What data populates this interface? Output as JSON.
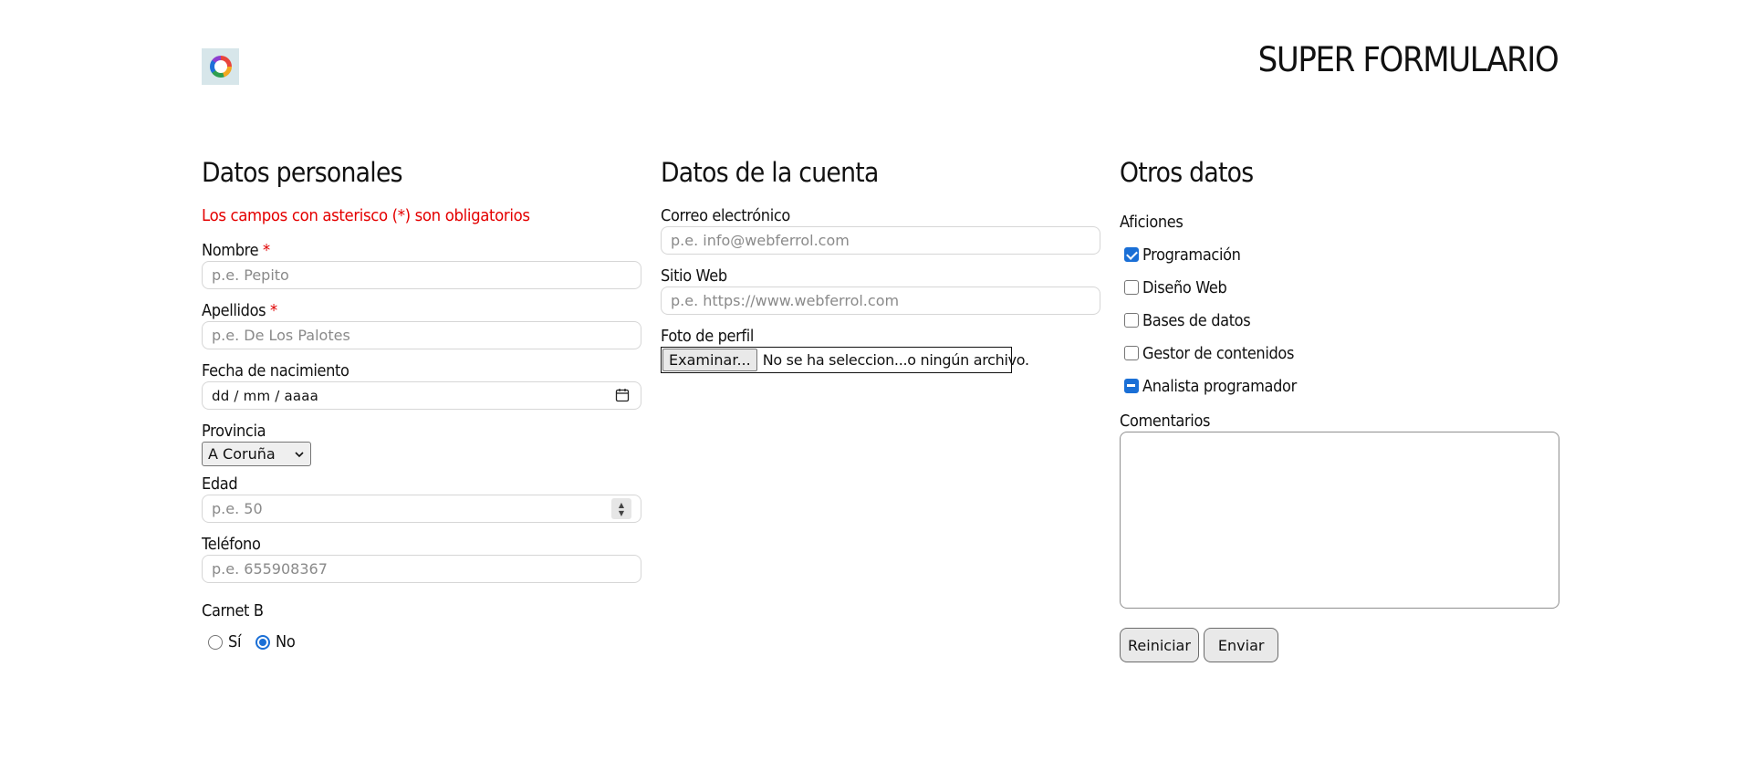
{
  "header": {
    "title": "SUPER FORMULARIO",
    "logo_icon": "ring-logo-icon"
  },
  "personal": {
    "title": "Datos personales",
    "required_note": "Los campos con asterisco (*) son obligatorios",
    "required_mark": "*",
    "nombre": {
      "label": "Nombre",
      "placeholder": "p.e. Pepito",
      "value": ""
    },
    "apellidos": {
      "label": "Apellidos",
      "placeholder": "p.e. De Los Palotes",
      "value": ""
    },
    "fecha": {
      "label": "Fecha de nacimiento",
      "display": "dd / mm / aaaa"
    },
    "provincia": {
      "label": "Provincia",
      "selected": "A Coruña"
    },
    "edad": {
      "label": "Edad",
      "placeholder": "p.e. 50",
      "value": ""
    },
    "telefono": {
      "label": "Teléfono",
      "placeholder": "p.e. 655908367",
      "value": ""
    },
    "carnet": {
      "label": "Carnet B",
      "options": [
        {
          "label": "Sí",
          "checked": false
        },
        {
          "label": "No",
          "checked": true
        }
      ]
    }
  },
  "account": {
    "title": "Datos de la cuenta",
    "email": {
      "label": "Correo electrónico",
      "placeholder": "p.e. info@webferrol.com",
      "value": ""
    },
    "web": {
      "label": "Sitio Web",
      "placeholder": "p.e. https://www.webferrol.com",
      "value": ""
    },
    "photo": {
      "label": "Foto de perfil",
      "button": "Examinar...",
      "status": "No se ha seleccion...o ningún archivo."
    }
  },
  "other": {
    "title": "Otros datos",
    "hobbies_label": "Aficiones",
    "hobbies": [
      {
        "label": "Programación",
        "state": "checked"
      },
      {
        "label": "Diseño Web",
        "state": "unchecked"
      },
      {
        "label": "Bases de datos",
        "state": "unchecked"
      },
      {
        "label": "Gestor de contenidos",
        "state": "unchecked"
      },
      {
        "label": "Analista programador",
        "state": "indeterminate"
      }
    ],
    "comments_label": "Comentarios",
    "comments_value": "",
    "reset_label": "Reiniciar",
    "submit_label": "Enviar"
  },
  "colors": {
    "accent": "#1a6fd6",
    "required": "#e40000"
  }
}
